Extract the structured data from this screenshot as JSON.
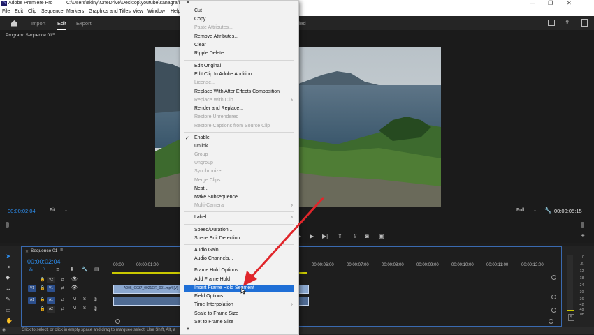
{
  "title_bar": {
    "app": "Adobe Premiere Pro",
    "path": "C:\\Users\\ekiny\\OneDrive\\Desktop\\youtube\\sanagrafi\\_p"
  },
  "menubar": [
    "File",
    "Edit",
    "Clip",
    "Sequence",
    "Markers",
    "Graphics and Titles",
    "View",
    "Window",
    "Help"
  ],
  "header": {
    "workspaces": [
      "Import",
      "Edit",
      "Export"
    ],
    "active": "Edit",
    "trailing_text": "lled"
  },
  "program_monitor": {
    "title": "Program: Sequence 01",
    "timecode_current": "00:00:02:04",
    "fit": "Fit",
    "quality": "Full",
    "timecode_duration": "00:00:05:15"
  },
  "timeline": {
    "title": "Sequence 01",
    "timecode": "00:00:02:04",
    "ruler": [
      "00:00",
      "00:00:01:00",
      "00:00:06:00",
      "00:00:07:00",
      "00:00:08:00",
      "00:00:09:00",
      "00:00:10:00",
      "00:00:11:00",
      "00:00:12:00"
    ],
    "tracks": [
      "V2",
      "V1",
      "A1",
      "A2"
    ],
    "track_source": [
      "V1",
      "A1"
    ],
    "clip_name": "A005_C037_0921GR_001.mp4 [V]",
    "meter_labels": [
      "0",
      "-6",
      "-12",
      "-18",
      "-24",
      "-30",
      "-36",
      "-42",
      "-48",
      "dB"
    ],
    "meter_solo": "S"
  },
  "status_bar": "Click to select, or click in empty space and drag to marquee select. Use Shift, Alt, a",
  "context_menu": {
    "items": [
      {
        "label": "Cut",
        "enabled": true
      },
      {
        "label": "Copy",
        "enabled": true
      },
      {
        "label": "Paste Attributes...",
        "enabled": false
      },
      {
        "label": "Remove Attributes...",
        "enabled": true
      },
      {
        "label": "Clear",
        "enabled": true
      },
      {
        "label": "Ripple Delete",
        "enabled": true
      },
      {
        "sep": true
      },
      {
        "label": "Edit Original",
        "enabled": true
      },
      {
        "label": "Edit Clip In Adobe Audition",
        "enabled": true
      },
      {
        "label": "License...",
        "enabled": false
      },
      {
        "label": "Replace With After Effects Composition",
        "enabled": true
      },
      {
        "label": "Replace With Clip",
        "enabled": false,
        "submenu": true
      },
      {
        "label": "Render and Replace...",
        "enabled": true
      },
      {
        "label": "Restore Unrendered",
        "enabled": false
      },
      {
        "label": "Restore Captions from Source Clip",
        "enabled": false
      },
      {
        "sep": true
      },
      {
        "label": "Enable",
        "enabled": true,
        "checked": true
      },
      {
        "label": "Unlink",
        "enabled": true
      },
      {
        "label": "Group",
        "enabled": false
      },
      {
        "label": "Ungroup",
        "enabled": false
      },
      {
        "label": "Synchronize",
        "enabled": false
      },
      {
        "label": "Merge Clips...",
        "enabled": false
      },
      {
        "label": "Nest...",
        "enabled": true
      },
      {
        "label": "Make Subsequence",
        "enabled": true
      },
      {
        "label": "Multi-Camera",
        "enabled": false,
        "submenu": true
      },
      {
        "sep": true
      },
      {
        "label": "Label",
        "enabled": true,
        "submenu": true
      },
      {
        "sep": true
      },
      {
        "label": "Speed/Duration...",
        "enabled": true
      },
      {
        "label": "Scene Edit Detection...",
        "enabled": true
      },
      {
        "sep": true
      },
      {
        "label": "Audio Gain...",
        "enabled": true
      },
      {
        "label": "Audio Channels...",
        "enabled": true
      },
      {
        "sep": true
      },
      {
        "label": "Frame Hold Options...",
        "enabled": true
      },
      {
        "label": "Add Frame Hold",
        "enabled": true
      },
      {
        "label": "Insert Frame Hold Segment",
        "enabled": true,
        "highlighted": true
      },
      {
        "label": "Field Options...",
        "enabled": true
      },
      {
        "label": "Time Interpolation",
        "enabled": true,
        "submenu": true
      },
      {
        "label": "Scale to Frame Size",
        "enabled": true
      },
      {
        "label": "Set to Frame Size",
        "enabled": true
      }
    ]
  },
  "colors": {
    "accent": "#2d8ceb",
    "highlight": "#1f6fd6",
    "annotation_arrow": "#e0262b"
  }
}
